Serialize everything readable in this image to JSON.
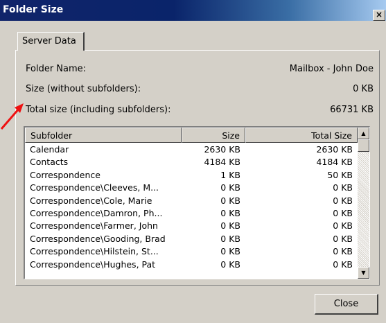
{
  "window": {
    "title": "Folder Size",
    "close_glyph": "×"
  },
  "tabs": [
    {
      "label": "Server Data"
    }
  ],
  "info": {
    "folder_name_label": "Folder Name:",
    "folder_name_value": "Mailbox - John Doe",
    "size_label": "Size (without subfolders):",
    "size_value": "0 KB",
    "total_label": "Total size (including subfolders):",
    "total_value": "66731 KB"
  },
  "table": {
    "columns": [
      "Subfolder",
      "Size",
      "Total Size"
    ],
    "rows": [
      {
        "name": "Calendar",
        "size": "2630 KB",
        "total": "2630 KB"
      },
      {
        "name": "Contacts",
        "size": "4184 KB",
        "total": "4184 KB"
      },
      {
        "name": "Correspondence",
        "size": "1 KB",
        "total": "50 KB"
      },
      {
        "name": "Correspondence\\Cleeves, M...",
        "size": "0 KB",
        "total": "0 KB"
      },
      {
        "name": "Correspondence\\Cole, Marie",
        "size": "0 KB",
        "total": "0 KB"
      },
      {
        "name": "Correspondence\\Damron, Ph...",
        "size": "0 KB",
        "total": "0 KB"
      },
      {
        "name": "Correspondence\\Farmer, John",
        "size": "0 KB",
        "total": "0 KB"
      },
      {
        "name": "Correspondence\\Gooding, Brad",
        "size": "0 KB",
        "total": "0 KB"
      },
      {
        "name": "Correspondence\\Hilstein, St...",
        "size": "0 KB",
        "total": "0 KB"
      },
      {
        "name": "Correspondence\\Hughes, Pat",
        "size": "0 KB",
        "total": "0 KB"
      }
    ]
  },
  "footer": {
    "close_label": "Close"
  },
  "colors": {
    "annotation_arrow": "#ee1111",
    "dialog_face": "#d4d0c8",
    "title_bar": "#0a246a"
  },
  "icons": {
    "scroll_up": "scroll-up-arrow-icon",
    "scroll_down": "scroll-down-arrow-icon",
    "annotation": "red-arrow-icon"
  }
}
